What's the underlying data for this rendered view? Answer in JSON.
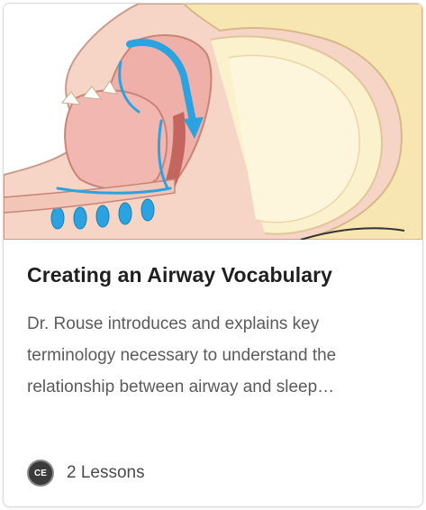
{
  "course": {
    "image_alt": "airway anatomy illustration",
    "title": "Creating an Airway Vocabulary",
    "description": "Dr. Rouse introduces and explains key terminology necessary to understand the relationship between airway and sleep…",
    "badge_text": "CE",
    "lessons_label": "2 Lessons"
  },
  "colors": {
    "arrow_blue": "#2aa3e0",
    "bone": "#f7e6b2",
    "tissue_pink": "#eeb0a8",
    "skin": "#f6d4c6"
  }
}
